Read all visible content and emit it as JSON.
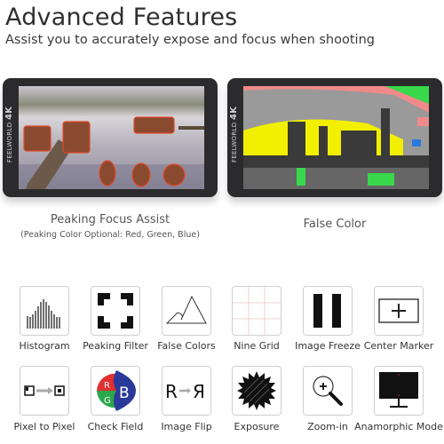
{
  "header": {
    "title": "Advanced Features",
    "subtitle": "Assist you to accurately expose and focus when shooting"
  },
  "monitors": [
    {
      "brand": "FEELWORLD",
      "badge": "4K",
      "caption": "Peaking Focus Assist",
      "sub_caption": "(Peaking Color Optional: Red, Green, Blue)"
    },
    {
      "brand": "FEELWORLD",
      "badge": "4K",
      "caption": "False Color"
    }
  ],
  "features": [
    {
      "label": "Histogram",
      "icon": "histogram-icon"
    },
    {
      "label": "Peaking Filter",
      "icon": "peaking-frame-icon"
    },
    {
      "label": "False Colors",
      "icon": "mountain-icon"
    },
    {
      "label": "Nine Grid",
      "icon": "grid-icon"
    },
    {
      "label": "Image Freeze",
      "icon": "pause-icon"
    },
    {
      "label": "Center Marker",
      "icon": "crosshair-icon"
    },
    {
      "label": "Pixel to Pixel",
      "icon": "pixel-arrow-icon"
    },
    {
      "label": "Check Field",
      "icon": "rgb-icon",
      "letters": [
        "R",
        "G",
        "B"
      ]
    },
    {
      "label": "Image Flip",
      "icon": "flip-icon",
      "letters": [
        "R",
        "Я"
      ]
    },
    {
      "label": "Exposure",
      "icon": "sun-icon"
    },
    {
      "label": "Zoom-in",
      "icon": "magnifier-icon"
    },
    {
      "label": "Anamorphic Mode",
      "icon": "monitor-icon"
    }
  ],
  "colors": {
    "peaking": "#e04a2a",
    "false_yellow": "#f2f000",
    "false_pink": "#f08a8a",
    "false_green": "#38d84a",
    "rgb_red": "#e03030",
    "rgb_green": "#2aa84a",
    "rgb_blue": "#2a3a9a"
  }
}
